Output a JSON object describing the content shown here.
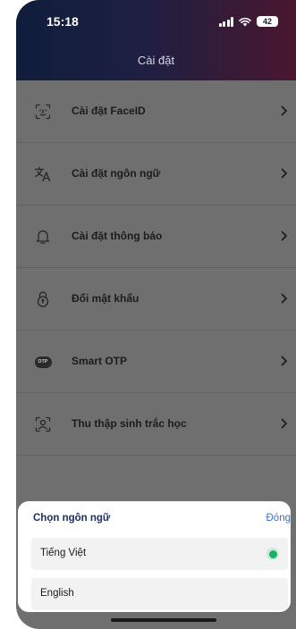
{
  "status_bar": {
    "time": "15:18",
    "battery": "42"
  },
  "header": {
    "title": "Cài đặt"
  },
  "menu": {
    "items": [
      {
        "label": "Cài đặt FaceID",
        "icon": "faceid-icon"
      },
      {
        "label": "Cài đặt ngôn ngữ",
        "icon": "translate-icon"
      },
      {
        "label": "Cài đặt thông báo",
        "icon": "bell-icon"
      },
      {
        "label": "Đổi mật khẩu",
        "icon": "lock-icon"
      },
      {
        "label": "Smart OTP",
        "icon": "otp-icon",
        "badge": "OTP"
      },
      {
        "label": "Thu thập sinh trắc học",
        "icon": "biometric-icon"
      }
    ]
  },
  "language_sheet": {
    "title": "Chọn ngôn ngữ",
    "close_label": "Đóng",
    "options": [
      {
        "label": "Tiếng Việt",
        "selected": true
      },
      {
        "label": "English",
        "selected": false
      }
    ]
  },
  "colors": {
    "accent": "#3f6fc8",
    "selected_radio": "#17b26a",
    "sheet_title": "#1f2e63"
  }
}
